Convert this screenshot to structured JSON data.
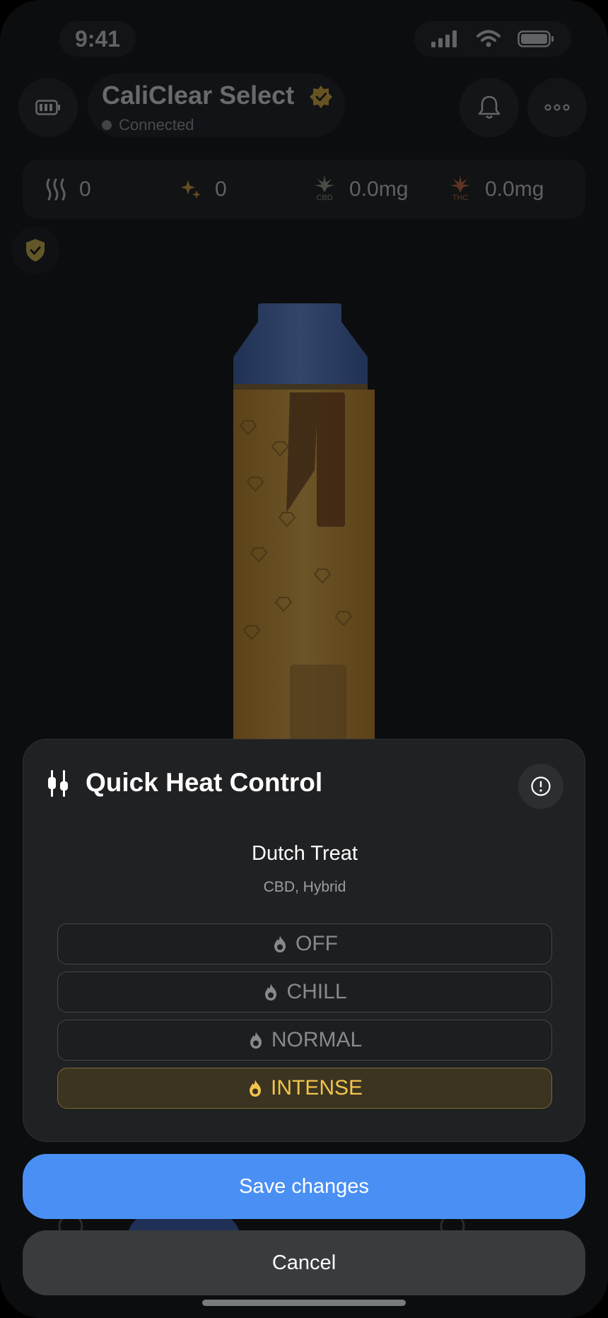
{
  "status_bar": {
    "time": "9:41"
  },
  "header": {
    "device_name": "CaliClear Select",
    "connection_status": "Connected",
    "icons": [
      "battery-icon",
      "verified-badge-icon",
      "bell-icon",
      "more-icon"
    ]
  },
  "stats": [
    {
      "icon": "heat-waves-icon",
      "value": "0"
    },
    {
      "icon": "sparkle-icon",
      "value": "0"
    },
    {
      "icon": "cbd-leaf-icon",
      "label": "CBD",
      "value": "0.0mg"
    },
    {
      "icon": "thc-leaf-icon",
      "label": "THC",
      "value": "0.0mg"
    }
  ],
  "colors": {
    "accent": "#4a90f4",
    "active": "#f3c44b",
    "sheet": "#202123",
    "device_cap": "#4a74c7",
    "device_body": "#e3a63a"
  },
  "sheet": {
    "title": "Quick Heat Control",
    "strain": {
      "name": "Dutch Treat",
      "type": "CBD, Hybrid"
    },
    "heat_options": [
      {
        "label": "OFF",
        "active": false
      },
      {
        "label": "CHILL",
        "active": false
      },
      {
        "label": "NORMAL",
        "active": false
      },
      {
        "label": "INTENSE",
        "active": true
      }
    ],
    "selected": "INTENSE"
  },
  "actions": {
    "save": "Save changes",
    "cancel": "Cancel"
  }
}
